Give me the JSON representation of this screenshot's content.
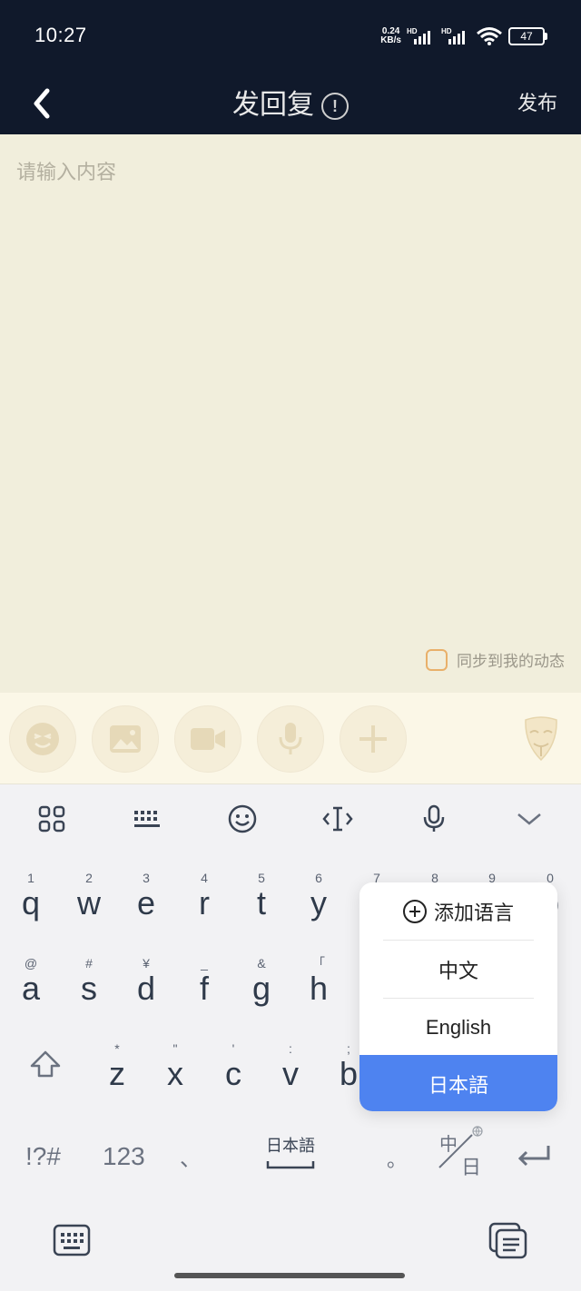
{
  "status": {
    "time": "10:27",
    "net_speed_value": "0.24",
    "net_speed_unit": "KB/s",
    "hd1": "HD",
    "hd2": "HD",
    "battery": "47"
  },
  "titlebar": {
    "title": "发回复",
    "info": "!",
    "publish": "发布"
  },
  "editor": {
    "placeholder": "请输入内容",
    "sync_label": "同步到我的动态"
  },
  "keyboard": {
    "row1": [
      {
        "sup": "1",
        "key": "q"
      },
      {
        "sup": "2",
        "key": "w"
      },
      {
        "sup": "3",
        "key": "e"
      },
      {
        "sup": "4",
        "key": "r"
      },
      {
        "sup": "5",
        "key": "t"
      },
      {
        "sup": "6",
        "key": "y"
      },
      {
        "sup": "7",
        "key": ""
      },
      {
        "sup": "8",
        "key": ""
      },
      {
        "sup": "9",
        "key": ""
      },
      {
        "sup": "0",
        "key": "p"
      }
    ],
    "row2": [
      {
        "sup": "@",
        "key": "a"
      },
      {
        "sup": "#",
        "key": "s"
      },
      {
        "sup": "¥",
        "key": "d"
      },
      {
        "sup": "_",
        "key": "f"
      },
      {
        "sup": "&",
        "key": "g"
      },
      {
        "sup": "「",
        "key": "h"
      }
    ],
    "row3": [
      {
        "sup": "*",
        "key": "z"
      },
      {
        "sup": "\"",
        "key": "x"
      },
      {
        "sup": "'",
        "key": "c"
      },
      {
        "sup": ":",
        "key": "v"
      },
      {
        "sup": ";",
        "key": "b"
      }
    ],
    "bottom": {
      "symbols": "!?#",
      "numbers": "123",
      "comma": "、",
      "space": "日本語",
      "period": "。",
      "lang_top": "中",
      "lang_bottom": "日"
    }
  },
  "language_popup": {
    "add": "添加语言",
    "options": [
      "中文",
      "English",
      "日本語"
    ],
    "selected": "日本語"
  },
  "colors": {
    "header_bg": "#10192b",
    "editor_bg": "#f1eedc",
    "accent_selected": "#4e83f0",
    "checkbox_border": "#e9b06a"
  }
}
